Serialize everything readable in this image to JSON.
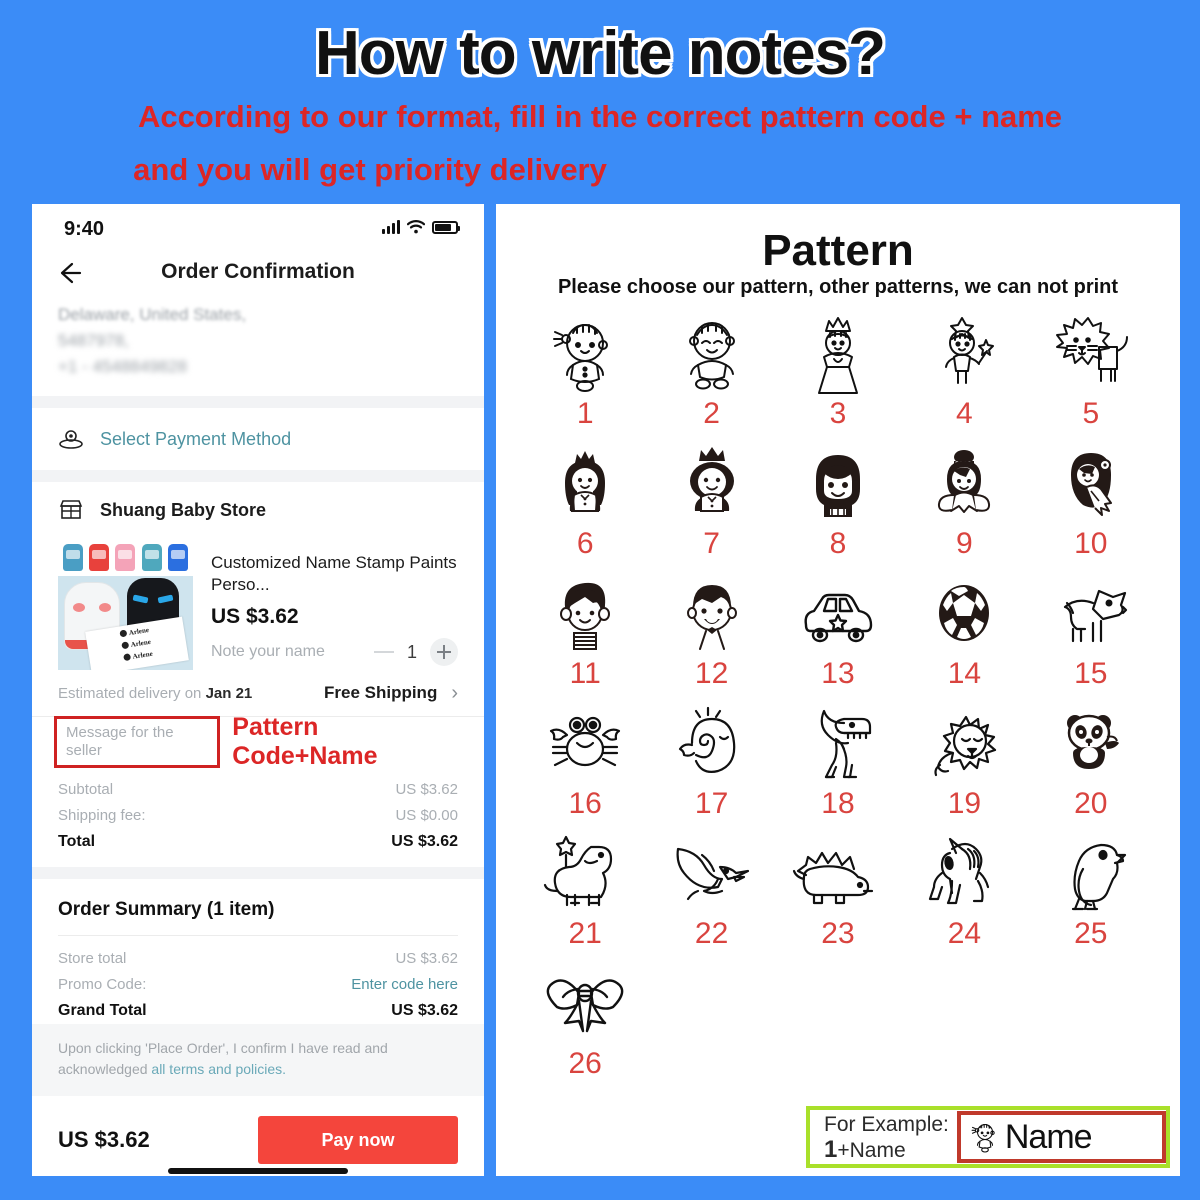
{
  "header": {
    "title": "How to write notes?",
    "subtitle_line1": "According to our format, fill in the correct pattern code + name",
    "subtitle_line2": "and you will get priority delivery",
    "title_color": "#111111",
    "subtitle_color": "#dc2626",
    "background_color": "#3b8cf7"
  },
  "phone": {
    "status_bar": {
      "time": "9:40",
      "signal_icon": "signal-bars-icon",
      "wifi_icon": "wifi-icon",
      "battery_icon": "battery-icon"
    },
    "nav": {
      "back_icon": "back-arrow-icon",
      "title": "Order Confirmation"
    },
    "address": {
      "line1": "Delaware, United States,",
      "line2": "5487978,",
      "line3": "+1 - 4548849828"
    },
    "payment": {
      "icon": "payment-method-icon",
      "label": "Select Payment Method",
      "label_color": "#4e93a1"
    },
    "store": {
      "icon": "store-icon",
      "name": "Shuang Baby Store"
    },
    "product": {
      "thumbnail_colors": [
        "#4a9ec4",
        "#e8413c",
        "#f4a3b8",
        "#4fa8bd",
        "#2b6fe0"
      ],
      "thumbnail_brand": "Arlene",
      "name": "Customized Name Stamp Paints Perso...",
      "price": "US $3.62",
      "note_placeholder": "Note your name",
      "quantity": "1",
      "minus_icon": "minus-icon",
      "plus_icon": "plus-icon"
    },
    "delivery": {
      "label_prefix": "Estimated delivery on ",
      "date": "Jan 21",
      "shipping": "Free Shipping",
      "chevron_icon": "chevron-right-icon"
    },
    "message": {
      "placeholder": "Message for the seller",
      "annotation": "Pattern Code+Name",
      "box_border_color": "#cf2222",
      "annotation_color": "#dc2626"
    },
    "totals": [
      {
        "label": "Subtotal",
        "value": "US $3.62",
        "strong": false
      },
      {
        "label": "Shipping fee:",
        "value": "US $0.00",
        "strong": false
      },
      {
        "label": "Total",
        "value": "US $3.62",
        "strong": true
      }
    ],
    "order_summary": {
      "title": "Order Summary (1 item)",
      "rows": [
        {
          "label": "Store total",
          "value": "US $3.62",
          "strong": false,
          "link": false
        },
        {
          "label": "Promo Code:",
          "value": "Enter code here",
          "strong": false,
          "link": true
        },
        {
          "label": "Grand Total",
          "value": "US $3.62",
          "strong": true,
          "link": false
        }
      ]
    },
    "terms": {
      "text": "Upon clicking 'Place Order', I confirm I have read and acknowledged ",
      "link": "all terms and policies."
    },
    "pay_bar": {
      "total": "US $3.62",
      "button_label": "Pay now",
      "button_color": "#f4453c"
    }
  },
  "pattern_panel": {
    "title": "Pattern",
    "subtitle": "Please choose our pattern, other patterns, we can not print",
    "number_color": "#d9443f",
    "items": [
      {
        "num": "1",
        "icon": "baby-girl-icon"
      },
      {
        "num": "2",
        "icon": "baby-boy-icon"
      },
      {
        "num": "3",
        "icon": "princess-icon"
      },
      {
        "num": "4",
        "icon": "fairy-wand-icon"
      },
      {
        "num": "5",
        "icon": "lion-outline-icon"
      },
      {
        "num": "6",
        "icon": "princess-girl-solid-icon"
      },
      {
        "num": "7",
        "icon": "crown-boy-solid-icon"
      },
      {
        "num": "8",
        "icon": "boy-solid-icon"
      },
      {
        "num": "9",
        "icon": "fairy-solid-icon"
      },
      {
        "num": "10",
        "icon": "mermaid-solid-icon"
      },
      {
        "num": "11",
        "icon": "boy-stripes-icon"
      },
      {
        "num": "12",
        "icon": "boy-bowtie-icon"
      },
      {
        "num": "13",
        "icon": "car-star-icon"
      },
      {
        "num": "14",
        "icon": "soccer-ball-icon"
      },
      {
        "num": "15",
        "icon": "fox-icon"
      },
      {
        "num": "16",
        "icon": "crab-icon"
      },
      {
        "num": "17",
        "icon": "whale-icon"
      },
      {
        "num": "18",
        "icon": "t-rex-icon"
      },
      {
        "num": "19",
        "icon": "lion-sleeping-icon"
      },
      {
        "num": "20",
        "icon": "panda-icon"
      },
      {
        "num": "21",
        "icon": "brontosaurus-icon"
      },
      {
        "num": "22",
        "icon": "pterodactyl-icon"
      },
      {
        "num": "23",
        "icon": "stegosaurus-icon"
      },
      {
        "num": "24",
        "icon": "unicorn-icon"
      },
      {
        "num": "25",
        "icon": "parrot-icon"
      },
      {
        "num": "26",
        "icon": "bow-ribbon-icon"
      }
    ],
    "example": {
      "label_line1": "For Example:",
      "label_code": "1",
      "label_suffix": "+Name",
      "stamp_name": "Name",
      "stamp_icon": "baby-girl-icon",
      "outer_border_color": "#a9e02a",
      "inner_border_color": "#c0392b"
    }
  }
}
